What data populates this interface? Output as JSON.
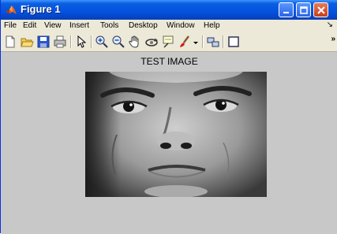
{
  "window": {
    "title": "Figure 1"
  },
  "menu": {
    "items": [
      "File",
      "Edit",
      "View",
      "Insert",
      "Tools",
      "Desktop",
      "Window",
      "Help"
    ]
  },
  "toolbar": {
    "buttons": [
      "new-file-icon",
      "open-folder-icon",
      "save-icon",
      "print-icon",
      "arrow-pointer-icon",
      "zoom-in-icon",
      "zoom-out-icon",
      "pan-hand-icon",
      "rotate-3d-icon",
      "data-cursor-icon",
      "brush-icon",
      "link-plot-icon",
      "colorbar-icon"
    ]
  },
  "figure": {
    "title": "TEST IMAGE",
    "image_description": "grayscale face image"
  }
}
